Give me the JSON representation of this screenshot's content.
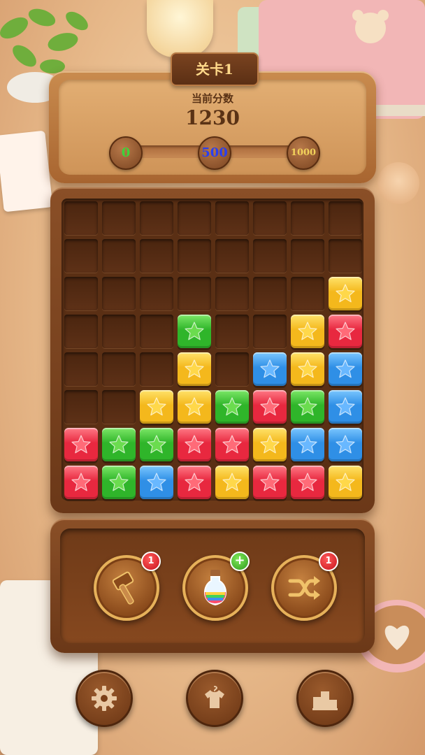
{
  "level": {
    "label": "关卡1"
  },
  "score": {
    "label": "当前分数",
    "value": "1230"
  },
  "progress": {
    "milestones": [
      {
        "value": "0",
        "color": "#3fd23a"
      },
      {
        "value": "500",
        "color": "#2a3ff0"
      },
      {
        "value": "1000",
        "color": "#f2d25a"
      }
    ],
    "fraction": 1.0
  },
  "board": {
    "rows": 8,
    "cols": 8,
    "cells": [
      "........",
      "........",
      ".......Y",
      "....G..YR",
      "....Y.BYB",
      "...YYGRGB",
      "RGGRRYBB",
      "RGBRYRRY"
    ],
    "colors": {
      "R": {
        "name": "red",
        "base": "#e8283f",
        "light": "#ff7a86",
        "star": "#ff6b78"
      },
      "G": {
        "name": "green",
        "base": "#2fb52a",
        "light": "#7ee868",
        "star": "#6bdc4f"
      },
      "B": {
        "name": "blue",
        "base": "#2f8fe6",
        "light": "#7cc7ff",
        "star": "#69b8ff"
      },
      "Y": {
        "name": "yellow",
        "base": "#f4b81c",
        "light": "#ffe36b",
        "star": "#ffd84a"
      }
    }
  },
  "powerups": [
    {
      "name": "hammer",
      "icon": "hammer-icon",
      "badge": "1",
      "badge_type": "count"
    },
    {
      "name": "rainbow-potion",
      "icon": "rainbow-potion-icon",
      "badge": "+",
      "badge_type": "add"
    },
    {
      "name": "shuffle",
      "icon": "shuffle-icon",
      "badge": "1",
      "badge_type": "count"
    }
  ],
  "nav": [
    {
      "name": "settings",
      "icon": "gear-icon"
    },
    {
      "name": "skins",
      "icon": "shirt-icon"
    },
    {
      "name": "leaderboard",
      "icon": "podium-icon"
    }
  ]
}
